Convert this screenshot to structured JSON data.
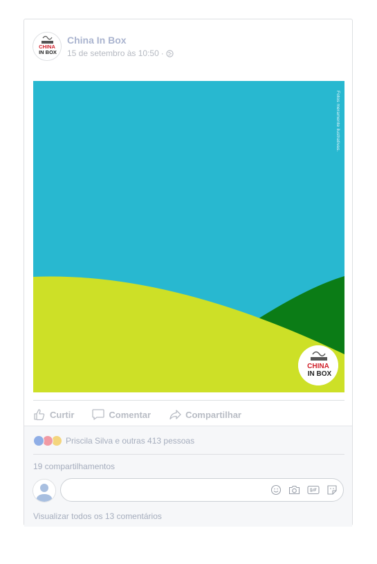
{
  "post": {
    "page_name": "China In Box",
    "timestamp": "15 de setembro às 10:50",
    "separator": "·",
    "privacy_icon": "globe-icon"
  },
  "photo": {
    "disclaimer": "Fotos meramente ilustrativas.",
    "logo_text_line1": "CHINA",
    "logo_text_line2": "IN BOX",
    "colors": {
      "sky": "#28b8d0",
      "hill_green": "#0b7c16",
      "hill_lime": "#cde027"
    }
  },
  "actions": {
    "like": "Curtir",
    "comment": "Comentar",
    "share": "Compartilhar"
  },
  "footer": {
    "reactions_text": "Priscila Silva e outras 413 pessoas",
    "shares_text": "19 compartilhamentos",
    "comment_placeholder": "",
    "view_comments": "Visualizar todos os 13 comentários"
  }
}
